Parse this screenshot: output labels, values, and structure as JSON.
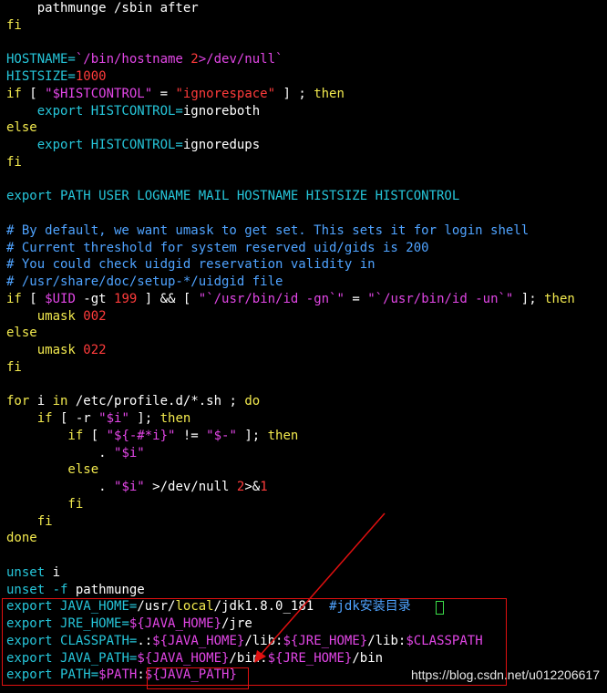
{
  "lines": [
    [
      {
        "t": "    pathmunge /sbin after",
        "c": "w"
      }
    ],
    [
      {
        "t": "fi",
        "c": "y"
      }
    ],
    [],
    [
      {
        "t": "HOSTNAME=",
        "c": "c"
      },
      {
        "t": "`/bin/hostname ",
        "c": "m"
      },
      {
        "t": "2",
        "c": "r"
      },
      {
        "t": ">/dev/null`",
        "c": "m"
      }
    ],
    [
      {
        "t": "HISTSIZE=",
        "c": "c"
      },
      {
        "t": "1000",
        "c": "r"
      }
    ],
    [
      {
        "t": "if",
        "c": "y"
      },
      {
        "t": " [ ",
        "c": "w"
      },
      {
        "t": "\"$HISTCONTROL\"",
        "c": "m"
      },
      {
        "t": " = ",
        "c": "w"
      },
      {
        "t": "\"ignorespace\"",
        "c": "r"
      },
      {
        "t": " ] ; ",
        "c": "w"
      },
      {
        "t": "then",
        "c": "y"
      }
    ],
    [
      {
        "t": "    export ",
        "c": "c"
      },
      {
        "t": "HISTCONTROL=",
        "c": "c"
      },
      {
        "t": "ignoreboth",
        "c": "w"
      }
    ],
    [
      {
        "t": "else",
        "c": "y"
      }
    ],
    [
      {
        "t": "    export ",
        "c": "c"
      },
      {
        "t": "HISTCONTROL=",
        "c": "c"
      },
      {
        "t": "ignoredups",
        "c": "w"
      }
    ],
    [
      {
        "t": "fi",
        "c": "y"
      }
    ],
    [],
    [
      {
        "t": "export PATH USER LOGNAME MAIL HOSTNAME HISTSIZE HISTCONTROL",
        "c": "c"
      }
    ],
    [],
    [
      {
        "t": "# By default, we want umask to get set. This sets it for login shell",
        "c": "b"
      }
    ],
    [
      {
        "t": "# Current threshold for system reserved uid/gids is 200",
        "c": "b"
      }
    ],
    [
      {
        "t": "# You could check uidgid reservation validity in",
        "c": "b"
      }
    ],
    [
      {
        "t": "# /usr/share/doc/setup-*/uidgid file",
        "c": "b"
      }
    ],
    [
      {
        "t": "if",
        "c": "y"
      },
      {
        "t": " [ ",
        "c": "w"
      },
      {
        "t": "$UID",
        "c": "m"
      },
      {
        "t": " -gt ",
        "c": "w"
      },
      {
        "t": "199",
        "c": "r"
      },
      {
        "t": " ] && [ ",
        "c": "w"
      },
      {
        "t": "\"`/usr/bin/id -gn`\"",
        "c": "m"
      },
      {
        "t": " = ",
        "c": "w"
      },
      {
        "t": "\"`/usr/bin/id -un`\"",
        "c": "m"
      },
      {
        "t": " ]; ",
        "c": "w"
      },
      {
        "t": "then",
        "c": "y"
      }
    ],
    [
      {
        "t": "    umask ",
        "c": "y"
      },
      {
        "t": "002",
        "c": "r"
      }
    ],
    [
      {
        "t": "else",
        "c": "y"
      }
    ],
    [
      {
        "t": "    umask ",
        "c": "y"
      },
      {
        "t": "022",
        "c": "r"
      }
    ],
    [
      {
        "t": "fi",
        "c": "y"
      }
    ],
    [],
    [
      {
        "t": "for",
        "c": "y"
      },
      {
        "t": " i ",
        "c": "w"
      },
      {
        "t": "in",
        "c": "y"
      },
      {
        "t": " /etc/profile.d/*.sh ; ",
        "c": "w"
      },
      {
        "t": "do",
        "c": "y"
      }
    ],
    [
      {
        "t": "    if",
        "c": "y"
      },
      {
        "t": " [ -r ",
        "c": "w"
      },
      {
        "t": "\"$i\"",
        "c": "m"
      },
      {
        "t": " ]; ",
        "c": "w"
      },
      {
        "t": "then",
        "c": "y"
      }
    ],
    [
      {
        "t": "        if",
        "c": "y"
      },
      {
        "t": " [ ",
        "c": "w"
      },
      {
        "t": "\"${-#*i}\"",
        "c": "m"
      },
      {
        "t": " != ",
        "c": "w"
      },
      {
        "t": "\"$-\"",
        "c": "m"
      },
      {
        "t": " ]; ",
        "c": "w"
      },
      {
        "t": "then",
        "c": "y"
      }
    ],
    [
      {
        "t": "            . ",
        "c": "w"
      },
      {
        "t": "\"$i\"",
        "c": "m"
      }
    ],
    [
      {
        "t": "        else",
        "c": "y"
      }
    ],
    [
      {
        "t": "            . ",
        "c": "w"
      },
      {
        "t": "\"$i\"",
        "c": "m"
      },
      {
        "t": " >/dev/null ",
        "c": "w"
      },
      {
        "t": "2",
        "c": "r"
      },
      {
        "t": ">&",
        "c": "w"
      },
      {
        "t": "1",
        "c": "r"
      }
    ],
    [
      {
        "t": "        fi",
        "c": "y"
      }
    ],
    [
      {
        "t": "    fi",
        "c": "y"
      }
    ],
    [
      {
        "t": "done",
        "c": "y"
      }
    ],
    [],
    [
      {
        "t": "unset",
        "c": "c"
      },
      {
        "t": " i",
        "c": "w"
      }
    ],
    [
      {
        "t": "unset",
        "c": "c"
      },
      {
        "t": " -f ",
        "c": "c"
      },
      {
        "t": "pathmunge",
        "c": "w"
      }
    ],
    [
      {
        "t": "export ",
        "c": "c"
      },
      {
        "t": "JAVA_HOME=",
        "c": "c"
      },
      {
        "t": "/usr/",
        "c": "w"
      },
      {
        "t": "local",
        "c": "y"
      },
      {
        "t": "/jdk1.8.0_181  ",
        "c": "w"
      },
      {
        "t": "#jdk安装目录",
        "c": "b"
      }
    ],
    [
      {
        "t": "export ",
        "c": "c"
      },
      {
        "t": "JRE_HOME=",
        "c": "c"
      },
      {
        "t": "${JAVA_HOME}",
        "c": "m"
      },
      {
        "t": "/jre",
        "c": "w"
      }
    ],
    [
      {
        "t": "export ",
        "c": "c"
      },
      {
        "t": "CLASSPATH=",
        "c": "c"
      },
      {
        "t": ".:",
        "c": "w"
      },
      {
        "t": "${JAVA_HOME}",
        "c": "m"
      },
      {
        "t": "/lib:",
        "c": "w"
      },
      {
        "t": "${JRE_HOME}",
        "c": "m"
      },
      {
        "t": "/lib:",
        "c": "w"
      },
      {
        "t": "$CLASSPATH",
        "c": "m"
      }
    ],
    [
      {
        "t": "export ",
        "c": "c"
      },
      {
        "t": "JAVA_PATH=",
        "c": "c"
      },
      {
        "t": "${JAVA_HOME}",
        "c": "m"
      },
      {
        "t": "/bin:",
        "c": "w"
      },
      {
        "t": "${JRE_HOME}",
        "c": "m"
      },
      {
        "t": "/bin",
        "c": "w"
      }
    ],
    [
      {
        "t": "export ",
        "c": "c"
      },
      {
        "t": "PATH=",
        "c": "c"
      },
      {
        "t": "$PATH",
        "c": "m"
      },
      {
        "t": ":",
        "c": "w"
      },
      {
        "t": "${JAVA_PATH}",
        "c": "m"
      }
    ]
  ],
  "watermark": "https://blog.csdn.net/u012206617",
  "colors": {
    "background": "#000000",
    "text": "#ffffff",
    "variable": "#26c6da",
    "keyword": "#f2e94e",
    "number": "#ff3b3b",
    "string": "#e246e6",
    "comment": "#4fa3ff",
    "annotation": "#e01010",
    "cursor": "#3ce04a"
  }
}
